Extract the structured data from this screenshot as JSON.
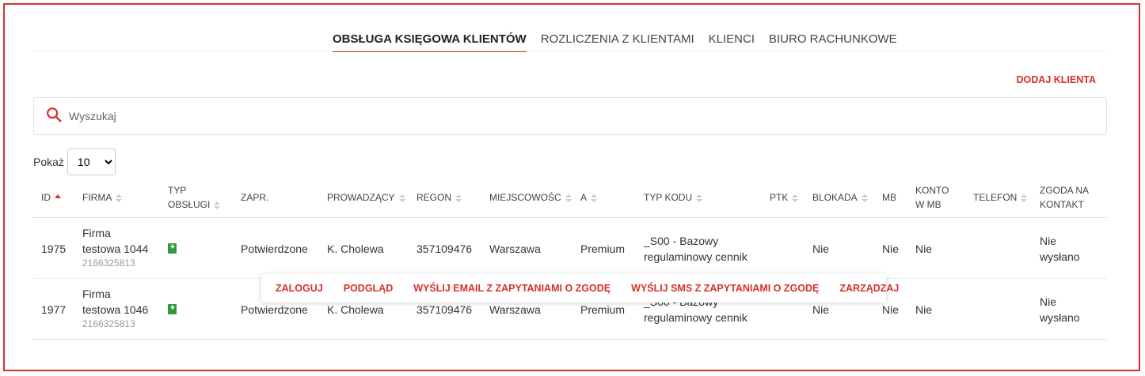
{
  "tabs": [
    "OBSŁUGA KSIĘGOWA KLIENTÓW",
    "ROZLICZENIA Z KLIENTAMI",
    "KLIENCI",
    "BIURO RACHUNKOWE"
  ],
  "add_client": "DODAJ KLIENTA",
  "search": {
    "placeholder": "Wyszukaj"
  },
  "page_size": {
    "label": "Pokaż",
    "value": "10"
  },
  "columns": {
    "id": "ID",
    "firma": "FIRMA",
    "typ1": "TYP",
    "typ2": "OBSŁUGI",
    "zapr": "ZAPR.",
    "prowadzacy": "PROWADZĄCY",
    "regon": "REGON",
    "miejscowosc": "MIEJSCOWOŚC",
    "a": "A",
    "typ_kodu": "TYP KODU",
    "ptk": "PTK",
    "blokada": "BLOKADA",
    "mb": "MB",
    "konto1": "KONTO",
    "konto2": "W MB",
    "telefon": "TELEFON",
    "zgoda1": "ZGODA NA",
    "zgoda2": "KONTAKT"
  },
  "rows": [
    {
      "id": "1975",
      "firma1": "Firma",
      "firma2": "testowa 1044",
      "nip": "2166325813",
      "zapr": "Potwierdzone",
      "prowadzacy": "K. Cholewa",
      "regon": "357109476",
      "miejscowosc": "Warszawa",
      "a": "Premium",
      "typ_kodu1": "_S00 - Bazowy",
      "typ_kodu2": "regulaminowy cennik",
      "blokada": "Nie",
      "mb": "Nie",
      "konto": "Nie",
      "zgoda1": "Nie",
      "zgoda2": "wysłano"
    },
    {
      "id": "1977",
      "firma1": "Firma",
      "firma2": "testowa 1046",
      "nip": "2166325813",
      "zapr": "Potwierdzone",
      "prowadzacy": "K. Cholewa",
      "regon": "357109476",
      "miejscowosc": "Warszawa",
      "a": "Premium",
      "typ_kodu1": "_S00 - Bazowy",
      "typ_kodu2": "regulaminowy cennik",
      "blokada": "Nie",
      "mb": "Nie",
      "konto": "Nie",
      "zgoda1": "Nie",
      "zgoda2": "wysłano"
    }
  ],
  "row_actions": [
    "ZALOGUJ",
    "PODGLĄD",
    "WYŚLIJ EMAIL Z ZAPYTANIAMI O ZGODĘ",
    "WYŚLIJ SMS Z ZAPYTANIAMI O ZGODĘ",
    "ZARZĄDZAJ"
  ],
  "colors": {
    "accent": "#d8302a",
    "icon_green": "#2e9b3a"
  }
}
